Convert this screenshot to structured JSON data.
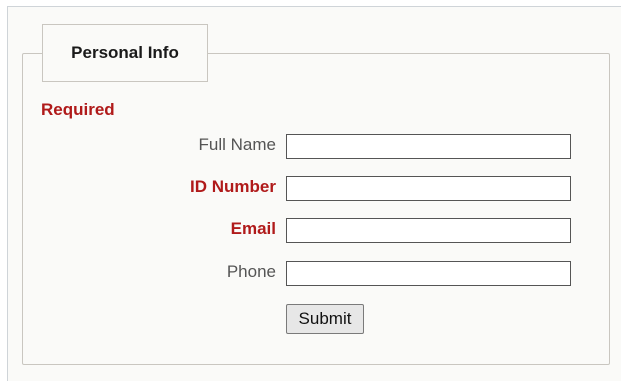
{
  "form": {
    "legend": "Personal Info",
    "required_note": "Required",
    "fields": [
      {
        "label": "Full Name",
        "required": false,
        "value": "",
        "placeholder": ""
      },
      {
        "label": "ID Number",
        "required": true,
        "value": "",
        "placeholder": ""
      },
      {
        "label": "Email",
        "required": true,
        "value": "",
        "placeholder": ""
      },
      {
        "label": "Phone",
        "required": false,
        "value": "",
        "placeholder": ""
      }
    ],
    "submit_label": "Submit"
  },
  "colors": {
    "required_text": "#b01a1a",
    "label_text": "#555555",
    "border": "#c9c6c0",
    "background": "#fafaf8"
  }
}
